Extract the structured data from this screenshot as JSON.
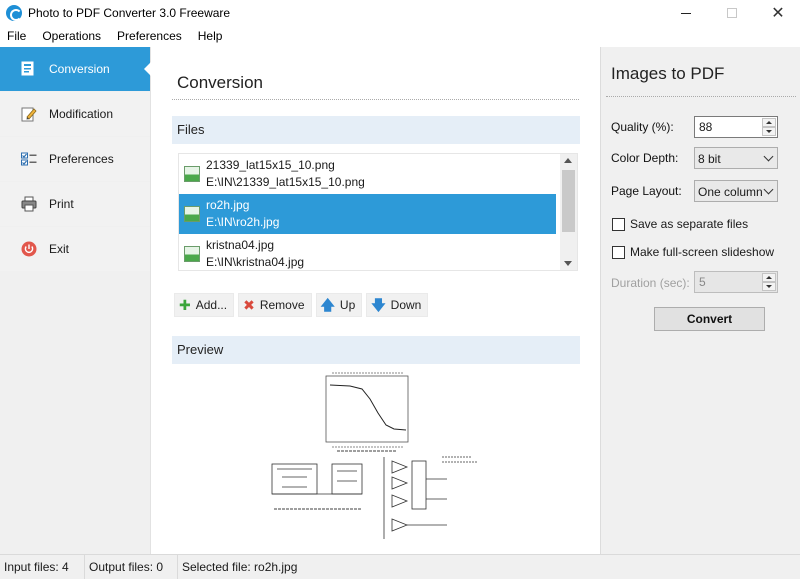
{
  "window": {
    "title": "Photo to PDF Converter 3.0 Freeware",
    "min_icon": "minimize-icon",
    "max_icon": "maximize-icon",
    "close_glyph": "✕"
  },
  "menu": [
    "File",
    "Operations",
    "Preferences",
    "Help"
  ],
  "sidebar": {
    "items": [
      {
        "label": "Conversion",
        "icon": "conversion-icon",
        "active": true
      },
      {
        "label": "Modification",
        "icon": "pencil-icon",
        "active": false
      },
      {
        "label": "Preferences",
        "icon": "checklist-icon",
        "active": false
      },
      {
        "label": "Print",
        "icon": "printer-icon",
        "active": false
      },
      {
        "label": "Exit",
        "icon": "power-icon",
        "active": false
      }
    ]
  },
  "main": {
    "title": "Conversion",
    "files_header": "Files",
    "preview_header": "Preview",
    "files": [
      {
        "name": "21339_lat15x15_10.png",
        "path": "E:\\IN\\21339_lat15x15_10.png",
        "selected": false
      },
      {
        "name": "ro2h.jpg",
        "path": "E:\\IN\\ro2h.jpg",
        "selected": true
      },
      {
        "name": "kristna04.jpg",
        "path": "E:\\IN\\kristna04.jpg",
        "selected": false
      }
    ],
    "buttons": {
      "add": "Add...",
      "remove": "Remove",
      "up": "Up",
      "down": "Down"
    }
  },
  "right": {
    "title": "Images to PDF",
    "quality_label": "Quality (%):",
    "quality_value": "88",
    "color_depth_label": "Color Depth:",
    "color_depth_value": "8 bit",
    "page_layout_label": "Page Layout:",
    "page_layout_value": "One column",
    "save_separate_label": "Save as separate files",
    "save_separate_checked": false,
    "slideshow_label": "Make full-screen slideshow",
    "slideshow_checked": false,
    "duration_label": "Duration (sec):",
    "duration_value": "5",
    "convert_label": "Convert"
  },
  "status": {
    "input": "Input files: 4",
    "output": "Output files: 0",
    "selected": "Selected file: ro2h.jpg"
  },
  "colors": {
    "accent": "#2d9ad8",
    "section_bg": "#e5eef7",
    "sidebar_bg": "#f0f0f0"
  }
}
